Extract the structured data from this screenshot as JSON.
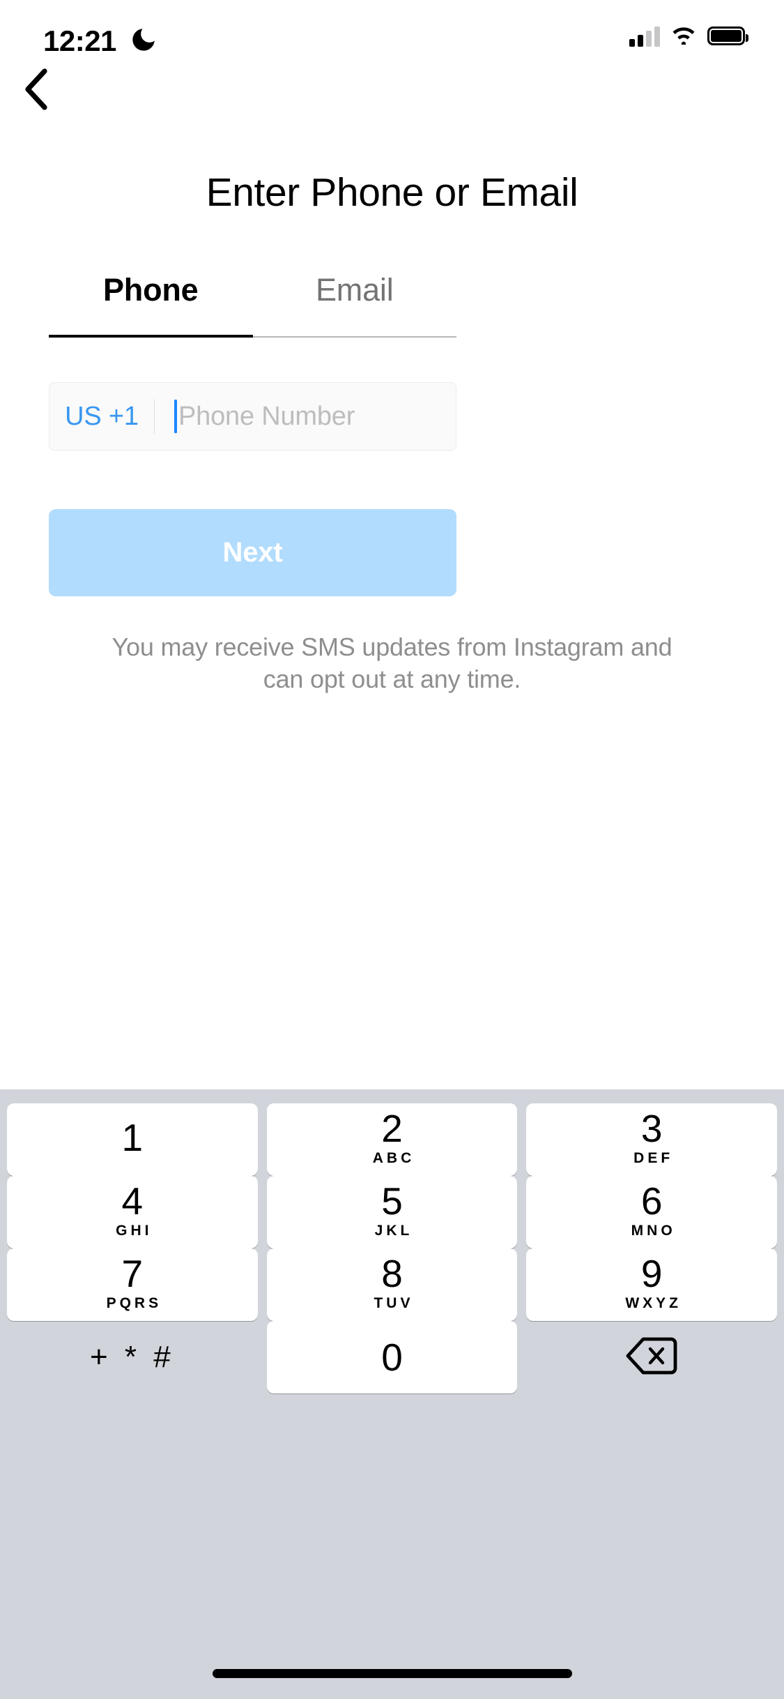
{
  "status_bar": {
    "time": "12:21",
    "dnd_icon": "crescent-moon-icon",
    "signal_icon": "cellular-signal-icon",
    "wifi_icon": "wifi-icon",
    "battery_icon": "battery-full-icon"
  },
  "nav": {
    "back_icon": "chevron-left-icon"
  },
  "header": {
    "title": "Enter Phone or Email"
  },
  "tabs": [
    {
      "label": "Phone",
      "active": true
    },
    {
      "label": "Email",
      "active": false
    }
  ],
  "phone_field": {
    "country_code": "US +1",
    "placeholder": "Phone Number",
    "value": "",
    "caret_color": "#1d86ff",
    "country_code_color": "#3897f0"
  },
  "primary_button": {
    "label": "Next",
    "background": "#b2dcfd",
    "text_color": "#ffffff",
    "enabled": false
  },
  "helper_text": "You may receive SMS updates from Instagram and can opt out at any time.",
  "keypad": {
    "background": "#d1d4da",
    "keys": [
      {
        "digit": "1",
        "letters": ""
      },
      {
        "digit": "2",
        "letters": "ABC"
      },
      {
        "digit": "3",
        "letters": "DEF"
      },
      {
        "digit": "4",
        "letters": "GHI"
      },
      {
        "digit": "5",
        "letters": "JKL"
      },
      {
        "digit": "6",
        "letters": "MNO"
      },
      {
        "digit": "7",
        "letters": "PQRS"
      },
      {
        "digit": "8",
        "letters": "TUV"
      },
      {
        "digit": "9",
        "letters": "WXYZ"
      },
      {
        "symbols": "+*#",
        "type": "symbols"
      },
      {
        "digit": "0",
        "letters": ""
      },
      {
        "icon": "backspace-icon",
        "type": "backspace"
      }
    ]
  },
  "home_indicator": "home-indicator-bar"
}
